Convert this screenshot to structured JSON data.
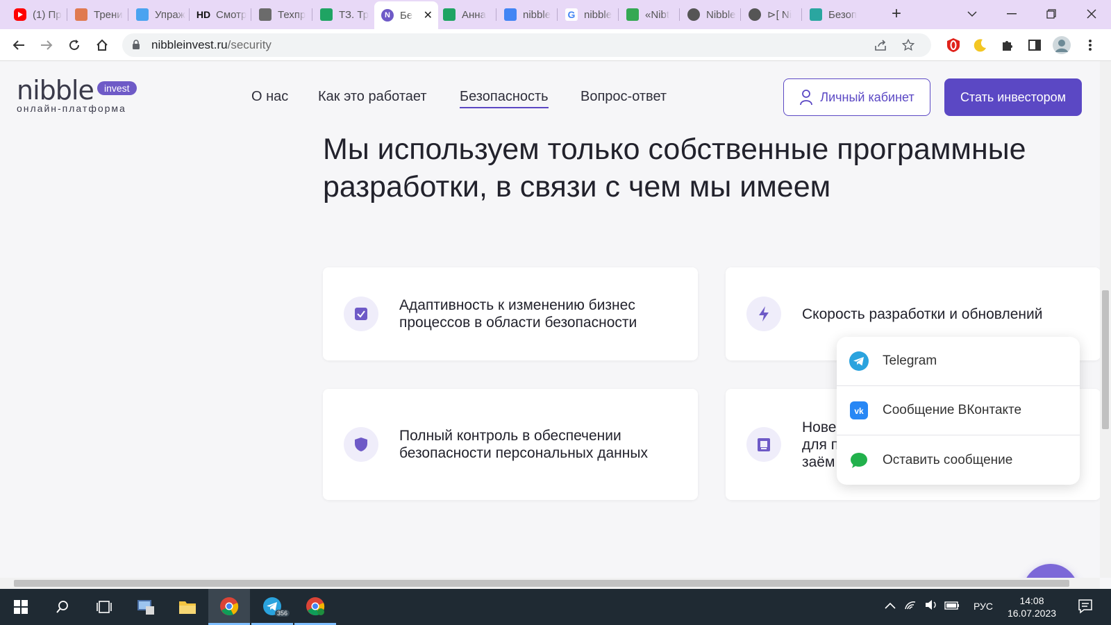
{
  "browser": {
    "tabs": [
      {
        "title": "(1) Пр",
        "icon": "youtube-icon",
        "color": "#ff0000"
      },
      {
        "title": "Трени",
        "icon": "avatar-icon",
        "color": "#e07a50"
      },
      {
        "title": "Упраж",
        "icon": "fr-icon",
        "color": "#4aa3f0"
      },
      {
        "title": "Смотр",
        "icon": "hd-icon",
        "color": "#222222"
      },
      {
        "title": "Техпр",
        "icon": "book-icon",
        "color": "#6b6b6b"
      },
      {
        "title": "ТЗ. Тр",
        "icon": "sheets-icon",
        "color": "#1fa463"
      },
      {
        "title": "Бе",
        "icon": "nibble-icon",
        "color": "#6e5ac7"
      },
      {
        "title": "Анна",
        "icon": "sheets-icon",
        "color": "#1fa463"
      },
      {
        "title": "nibble",
        "icon": "docs-icon",
        "color": "#4285f4"
      },
      {
        "title": "nibble",
        "icon": "google-icon",
        "color": "#4285f4"
      },
      {
        "title": "«Nibt",
        "icon": "grid-icon",
        "color": "#34a853"
      },
      {
        "title": "Nibble",
        "icon": "globe-icon",
        "color": "#555555"
      },
      {
        "title": "⊳[ Ni",
        "icon": "globe-icon",
        "color": "#555555"
      },
      {
        "title": "Безоп",
        "icon": "feather-icon",
        "color": "#2aa6a0"
      }
    ],
    "url_host": "nibbleinvest.ru",
    "url_path": "/security"
  },
  "site": {
    "logo_word": "nibble",
    "logo_badge": "invest",
    "logo_sub": "онлайн-платформа",
    "nav": [
      "О нас",
      "Как это работает",
      "Безопасность",
      "Вопрос-ответ"
    ],
    "active_nav": "Безопасность",
    "cabinet_label": "Личный кабинет",
    "invest_label": "Стать инвестором",
    "headline": "Мы используем только собственные программные разработки, в связи с чем мы имеем",
    "cards": [
      {
        "text": "Адаптивность к изменению бизнес процессов в области безопасности",
        "icon": "checkbox-icon"
      },
      {
        "text": "Скорость разработки и обновлений",
        "icon": "lightning-icon"
      },
      {
        "text": "Полный контроль в обеспечении безопасности персональных данных",
        "icon": "shield-icon"
      },
      {
        "text": "Нове\nдля п\nзаём",
        "icon": "clipboard-icon"
      }
    ]
  },
  "popup": {
    "items": [
      {
        "label": "Telegram",
        "icon": "telegram-icon",
        "color": "#2aa3de"
      },
      {
        "label": "Сообщение ВКонтакте",
        "icon": "vk-icon",
        "color": "#2787f5"
      },
      {
        "label": "Оставить сообщение",
        "icon": "chat-icon",
        "color": "#22b14c"
      }
    ]
  },
  "taskbar": {
    "telegram_badge": "356",
    "lang": "РУС",
    "time": "14:08",
    "date": "16.07.2023"
  },
  "colors": {
    "brand": "#5b48c4",
    "tab_strip": "#e8d9f7",
    "taskbar": "#1f2a33"
  }
}
